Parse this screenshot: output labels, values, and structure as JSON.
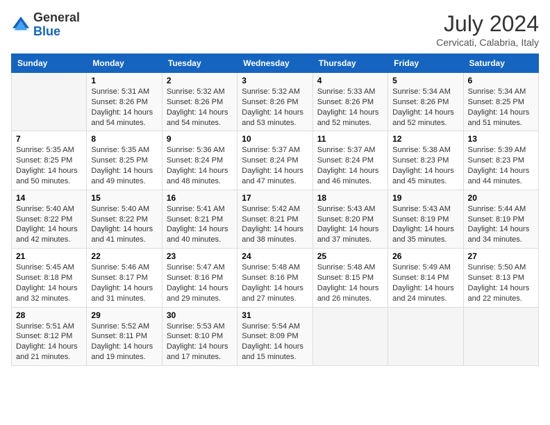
{
  "header": {
    "logo_general": "General",
    "logo_blue": "Blue",
    "month_year": "July 2024",
    "location": "Cervicati, Calabria, Italy"
  },
  "days_of_week": [
    "Sunday",
    "Monday",
    "Tuesday",
    "Wednesday",
    "Thursday",
    "Friday",
    "Saturday"
  ],
  "weeks": [
    [
      {
        "day": "",
        "sunrise": "",
        "sunset": "",
        "daylight": ""
      },
      {
        "day": "1",
        "sunrise": "Sunrise: 5:31 AM",
        "sunset": "Sunset: 8:26 PM",
        "daylight": "Daylight: 14 hours and 54 minutes."
      },
      {
        "day": "2",
        "sunrise": "Sunrise: 5:32 AM",
        "sunset": "Sunset: 8:26 PM",
        "daylight": "Daylight: 14 hours and 54 minutes."
      },
      {
        "day": "3",
        "sunrise": "Sunrise: 5:32 AM",
        "sunset": "Sunset: 8:26 PM",
        "daylight": "Daylight: 14 hours and 53 minutes."
      },
      {
        "day": "4",
        "sunrise": "Sunrise: 5:33 AM",
        "sunset": "Sunset: 8:26 PM",
        "daylight": "Daylight: 14 hours and 52 minutes."
      },
      {
        "day": "5",
        "sunrise": "Sunrise: 5:34 AM",
        "sunset": "Sunset: 8:26 PM",
        "daylight": "Daylight: 14 hours and 52 minutes."
      },
      {
        "day": "6",
        "sunrise": "Sunrise: 5:34 AM",
        "sunset": "Sunset: 8:25 PM",
        "daylight": "Daylight: 14 hours and 51 minutes."
      }
    ],
    [
      {
        "day": "7",
        "sunrise": "Sunrise: 5:35 AM",
        "sunset": "Sunset: 8:25 PM",
        "daylight": "Daylight: 14 hours and 50 minutes."
      },
      {
        "day": "8",
        "sunrise": "Sunrise: 5:35 AM",
        "sunset": "Sunset: 8:25 PM",
        "daylight": "Daylight: 14 hours and 49 minutes."
      },
      {
        "day": "9",
        "sunrise": "Sunrise: 5:36 AM",
        "sunset": "Sunset: 8:24 PM",
        "daylight": "Daylight: 14 hours and 48 minutes."
      },
      {
        "day": "10",
        "sunrise": "Sunrise: 5:37 AM",
        "sunset": "Sunset: 8:24 PM",
        "daylight": "Daylight: 14 hours and 47 minutes."
      },
      {
        "day": "11",
        "sunrise": "Sunrise: 5:37 AM",
        "sunset": "Sunset: 8:24 PM",
        "daylight": "Daylight: 14 hours and 46 minutes."
      },
      {
        "day": "12",
        "sunrise": "Sunrise: 5:38 AM",
        "sunset": "Sunset: 8:23 PM",
        "daylight": "Daylight: 14 hours and 45 minutes."
      },
      {
        "day": "13",
        "sunrise": "Sunrise: 5:39 AM",
        "sunset": "Sunset: 8:23 PM",
        "daylight": "Daylight: 14 hours and 44 minutes."
      }
    ],
    [
      {
        "day": "14",
        "sunrise": "Sunrise: 5:40 AM",
        "sunset": "Sunset: 8:22 PM",
        "daylight": "Daylight: 14 hours and 42 minutes."
      },
      {
        "day": "15",
        "sunrise": "Sunrise: 5:40 AM",
        "sunset": "Sunset: 8:22 PM",
        "daylight": "Daylight: 14 hours and 41 minutes."
      },
      {
        "day": "16",
        "sunrise": "Sunrise: 5:41 AM",
        "sunset": "Sunset: 8:21 PM",
        "daylight": "Daylight: 14 hours and 40 minutes."
      },
      {
        "day": "17",
        "sunrise": "Sunrise: 5:42 AM",
        "sunset": "Sunset: 8:21 PM",
        "daylight": "Daylight: 14 hours and 38 minutes."
      },
      {
        "day": "18",
        "sunrise": "Sunrise: 5:43 AM",
        "sunset": "Sunset: 8:20 PM",
        "daylight": "Daylight: 14 hours and 37 minutes."
      },
      {
        "day": "19",
        "sunrise": "Sunrise: 5:43 AM",
        "sunset": "Sunset: 8:19 PM",
        "daylight": "Daylight: 14 hours and 35 minutes."
      },
      {
        "day": "20",
        "sunrise": "Sunrise: 5:44 AM",
        "sunset": "Sunset: 8:19 PM",
        "daylight": "Daylight: 14 hours and 34 minutes."
      }
    ],
    [
      {
        "day": "21",
        "sunrise": "Sunrise: 5:45 AM",
        "sunset": "Sunset: 8:18 PM",
        "daylight": "Daylight: 14 hours and 32 minutes."
      },
      {
        "day": "22",
        "sunrise": "Sunrise: 5:46 AM",
        "sunset": "Sunset: 8:17 PM",
        "daylight": "Daylight: 14 hours and 31 minutes."
      },
      {
        "day": "23",
        "sunrise": "Sunrise: 5:47 AM",
        "sunset": "Sunset: 8:16 PM",
        "daylight": "Daylight: 14 hours and 29 minutes."
      },
      {
        "day": "24",
        "sunrise": "Sunrise: 5:48 AM",
        "sunset": "Sunset: 8:16 PM",
        "daylight": "Daylight: 14 hours and 27 minutes."
      },
      {
        "day": "25",
        "sunrise": "Sunrise: 5:48 AM",
        "sunset": "Sunset: 8:15 PM",
        "daylight": "Daylight: 14 hours and 26 minutes."
      },
      {
        "day": "26",
        "sunrise": "Sunrise: 5:49 AM",
        "sunset": "Sunset: 8:14 PM",
        "daylight": "Daylight: 14 hours and 24 minutes."
      },
      {
        "day": "27",
        "sunrise": "Sunrise: 5:50 AM",
        "sunset": "Sunset: 8:13 PM",
        "daylight": "Daylight: 14 hours and 22 minutes."
      }
    ],
    [
      {
        "day": "28",
        "sunrise": "Sunrise: 5:51 AM",
        "sunset": "Sunset: 8:12 PM",
        "daylight": "Daylight: 14 hours and 21 minutes."
      },
      {
        "day": "29",
        "sunrise": "Sunrise: 5:52 AM",
        "sunset": "Sunset: 8:11 PM",
        "daylight": "Daylight: 14 hours and 19 minutes."
      },
      {
        "day": "30",
        "sunrise": "Sunrise: 5:53 AM",
        "sunset": "Sunset: 8:10 PM",
        "daylight": "Daylight: 14 hours and 17 minutes."
      },
      {
        "day": "31",
        "sunrise": "Sunrise: 5:54 AM",
        "sunset": "Sunset: 8:09 PM",
        "daylight": "Daylight: 14 hours and 15 minutes."
      },
      {
        "day": "",
        "sunrise": "",
        "sunset": "",
        "daylight": ""
      },
      {
        "day": "",
        "sunrise": "",
        "sunset": "",
        "daylight": ""
      },
      {
        "day": "",
        "sunrise": "",
        "sunset": "",
        "daylight": ""
      }
    ]
  ]
}
